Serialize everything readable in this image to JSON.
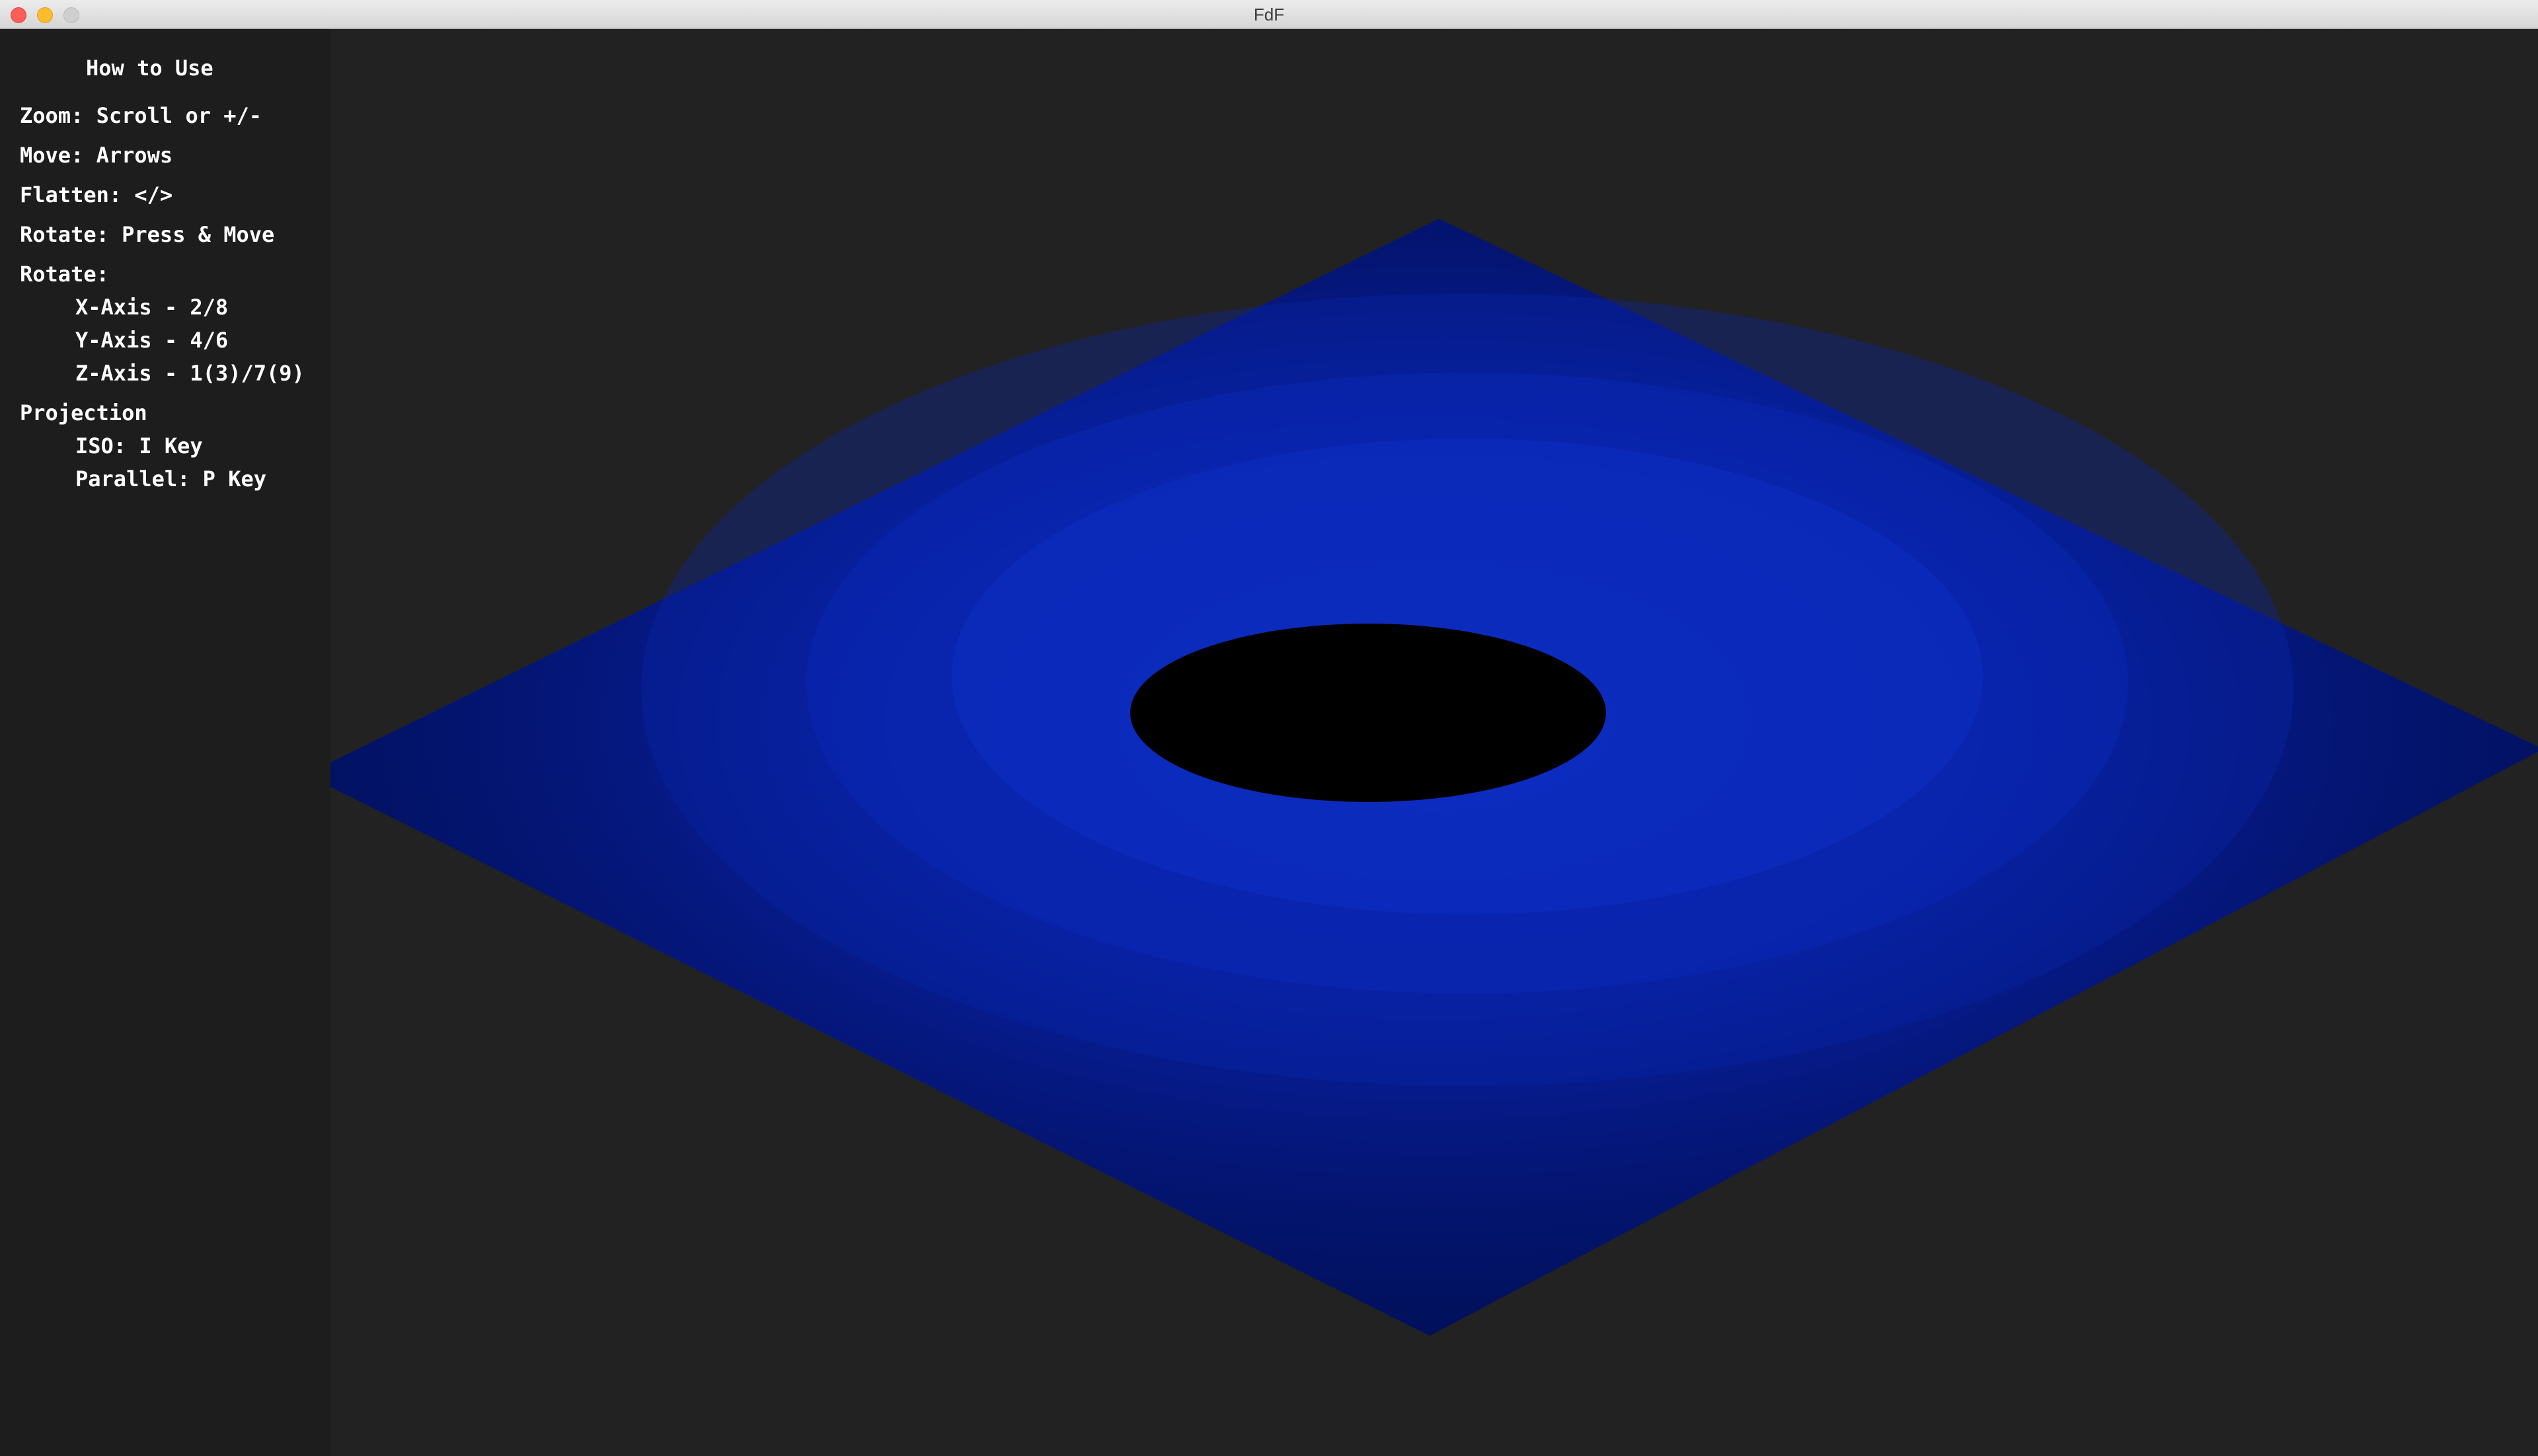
{
  "window": {
    "title": "FdF"
  },
  "help": {
    "heading": "How to Use",
    "lines": [
      "Zoom: Scroll or +/-",
      "Move: Arrows",
      "Flatten: </>",
      "Rotate: Press & Move",
      "Rotate:",
      "X-Axis - 2/8",
      "Y-Axis - 4/6",
      "Z-Axis - 1(3)/7(9)",
      "Projection",
      "ISO: I Key",
      "Parallel: P Key"
    ]
  },
  "colors": {
    "background": "#222222",
    "sidebar": "#1d1d1d",
    "plane_dark": "#00105a",
    "plane_light": "#0a2bb8",
    "peak_low": "#43a6ff",
    "peak_mid": "#40e0c0",
    "peak_high": "#e8602a",
    "hole": "#000000"
  }
}
